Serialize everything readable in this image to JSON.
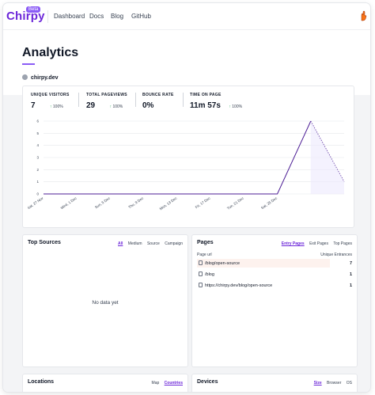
{
  "header": {
    "brand": "Chirpy",
    "badge": "Beta",
    "nav": [
      "Dashboard",
      "Docs",
      "Blog",
      "GitHub"
    ]
  },
  "page": {
    "title": "Analytics",
    "site": "chirpy.dev"
  },
  "stats": [
    {
      "label": "UNIQUE VISITORS",
      "value": "7",
      "change": "100%"
    },
    {
      "label": "TOTAL PAGEVIEWS",
      "value": "29",
      "change": "100%"
    },
    {
      "label": "BOUNCE RATE",
      "value": "0%",
      "change": ""
    },
    {
      "label": "TIME ON PAGE",
      "value": "11m 57s",
      "change": "100%"
    }
  ],
  "colors": {
    "accent": "#8b5cf6",
    "line": "#4c1d95",
    "positive": "#16a34a"
  },
  "chart_data": {
    "type": "line",
    "x": [
      "Sat, 27 Nov",
      "Wed, 1 Dec",
      "Sun, 5 Dec",
      "Thu, 9 Dec",
      "Mon, 13 Dec",
      "Fri, 17 Dec",
      "Tue, 21 Dec",
      "Sat, 25 Dec",
      "Sun, 26 Dec",
      "Mon, 27 Dec"
    ],
    "xticks": [
      "Sat, 27 Nov",
      "Wed, 1 Dec",
      "Sun, 5 Dec",
      "Thu, 9 Dec",
      "Mon, 13 Dec",
      "Fri, 17 Dec",
      "Tue, 21 Dec",
      "Sat, 25 Dec"
    ],
    "yticks": [
      0,
      1,
      2,
      3,
      4,
      5,
      6
    ],
    "ylim": [
      0,
      6
    ],
    "series": [
      {
        "solid_values": [
          0,
          0,
          0,
          0,
          0,
          0,
          0,
          0,
          6
        ],
        "dashed_values": [
          6,
          1
        ]
      }
    ],
    "grid": true
  },
  "top_sources": {
    "title": "Top Sources",
    "tabs": [
      "All",
      "Medium",
      "Source",
      "Campaign"
    ],
    "active_tab": "All",
    "empty": "No data yet"
  },
  "pages": {
    "title": "Pages",
    "tabs": [
      "Entry Pages",
      "Exit Pages",
      "Top Pages"
    ],
    "active_tab": "Entry Pages",
    "col_left": "Page url",
    "col_right": "Unique Entrances",
    "rows": [
      {
        "url": "/blog/open-source",
        "value": "7"
      },
      {
        "url": "/blog",
        "value": "1"
      },
      {
        "url": "https://chirpy.dev/blog/open-source",
        "value": "1"
      }
    ]
  },
  "locations": {
    "title": "Locations",
    "tabs": [
      "Map",
      "Countries"
    ],
    "active_tab": "Countries"
  },
  "devices": {
    "title": "Devices",
    "tabs": [
      "Size",
      "Browser",
      "OS"
    ],
    "active_tab": "Size"
  }
}
